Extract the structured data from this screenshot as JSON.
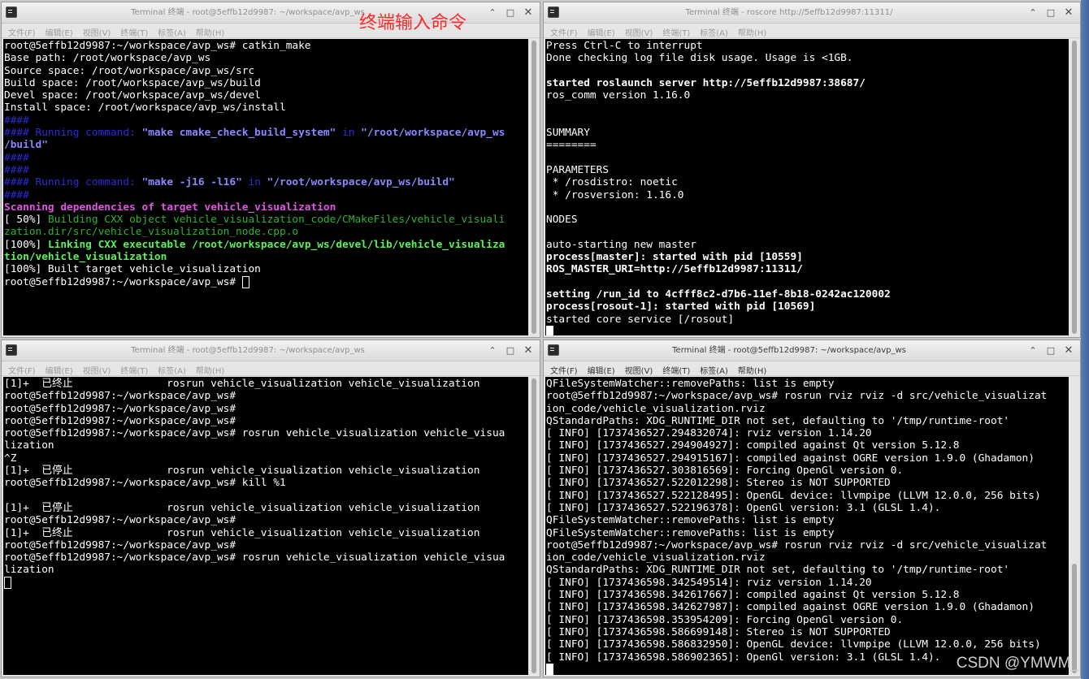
{
  "annotation": "终端输入命令",
  "watermark": "CSDN @YMWM_",
  "colors": {
    "terminal_bg": "#000000",
    "text": "#ffffff",
    "blue": "#2b2bd8",
    "light_blue": "#8888ff",
    "magenta": "#e055e0",
    "green": "#2fb22f",
    "light_green": "#5af25a",
    "annotation_red": "#ff2a2a"
  },
  "menu": [
    "文件(F)",
    "编辑(E)",
    "视图(V)",
    "终端(T)",
    "标签(A)",
    "帮助(H)"
  ],
  "controls": {
    "minimize": "⌃",
    "maximize": "□",
    "close": "✕"
  },
  "windows": [
    {
      "title": "Terminal 终端 - root@5effb12d9987: ~/workspace/avp_ws",
      "lines": [
        {
          "t": "root@5effb12d9987:~/workspace/avp_ws# catkin_make"
        },
        {
          "t": "Base path: /root/workspace/avp_ws"
        },
        {
          "t": "Source space: /root/workspace/avp_ws/src"
        },
        {
          "t": "Build space: /root/workspace/avp_ws/build"
        },
        {
          "t": "Devel space: /root/workspace/avp_ws/devel"
        },
        {
          "t": "Install space: /root/workspace/avp_ws/install"
        },
        {
          "t": "####",
          "c": "blue"
        },
        {
          "segs": [
            {
              "t": "#### Running command: ",
              "c": "blue"
            },
            {
              "t": "\"make cmake_check_build_system\"",
              "c": "lblue"
            },
            {
              "t": " in ",
              "c": "blue"
            },
            {
              "t": "\"/root/workspace/avp_ws",
              "c": "lblue"
            }
          ]
        },
        {
          "t": "/build\"",
          "c": "lblue"
        },
        {
          "t": "####",
          "c": "blue"
        },
        {
          "t": "####",
          "c": "blue"
        },
        {
          "segs": [
            {
              "t": "#### Running command: ",
              "c": "blue"
            },
            {
              "t": "\"make -j16 -l16\"",
              "c": "lblue"
            },
            {
              "t": " in ",
              "c": "blue"
            },
            {
              "t": "\"/root/workspace/avp_ws/build\"",
              "c": "lblue"
            }
          ]
        },
        {
          "t": "####",
          "c": "blue"
        },
        {
          "t": "Scanning dependencies of target vehicle_visualization",
          "c": "mag"
        },
        {
          "segs": [
            {
              "t": "[ 50%] "
            },
            {
              "t": "Building CXX object vehicle_visualization_code/CMakeFiles/vehicle_visuali",
              "c": "grn"
            }
          ]
        },
        {
          "t": "zation.dir/src/vehicle_visualization_node.cpp.o",
          "c": "grn"
        },
        {
          "segs": [
            {
              "t": "[100%] "
            },
            {
              "t": "Linking CXX executable /root/workspace/avp_ws/devel/lib/vehicle_visualiza",
              "c": "lgrn"
            }
          ]
        },
        {
          "t": "tion/vehicle_visualization",
          "c": "lgrn"
        },
        {
          "t": "[100%] Built target vehicle_visualization"
        },
        {
          "t": "root@5effb12d9987:~/workspace/avp_ws# ",
          "cursor": "hollow"
        }
      ]
    },
    {
      "title": "Terminal 终端 - roscore http://5effb12d9987:11311/",
      "lines": [
        {
          "t": "Press Ctrl-C to interrupt"
        },
        {
          "t": "Done checking log file disk usage. Usage is <1GB."
        },
        {
          "t": ""
        },
        {
          "t": "started roslaunch server http://5effb12d9987:38687/",
          "c": "b"
        },
        {
          "t": "ros_comm version 1.16.0"
        },
        {
          "t": ""
        },
        {
          "t": ""
        },
        {
          "t": "SUMMARY"
        },
        {
          "t": "========"
        },
        {
          "t": ""
        },
        {
          "t": "PARAMETERS"
        },
        {
          "t": " * /rosdistro: noetic"
        },
        {
          "t": " * /rosversion: 1.16.0"
        },
        {
          "t": ""
        },
        {
          "t": "NODES"
        },
        {
          "t": ""
        },
        {
          "t": "auto-starting new master"
        },
        {
          "t": "process[master]: started with pid [10559]",
          "c": "b"
        },
        {
          "t": "ROS_MASTER_URI=http://5effb12d9987:11311/",
          "c": "b"
        },
        {
          "t": ""
        },
        {
          "t": "setting /run_id to 4cfff8c2-d7b6-11ef-8b18-0242ac120002",
          "c": "b"
        },
        {
          "t": "process[rosout-1]: started with pid [10569]",
          "c": "b"
        },
        {
          "t": "started core service [/rosout]"
        },
        {
          "t": "",
          "cursor": "solid"
        }
      ]
    },
    {
      "title": "Terminal 终端 - root@5effb12d9987: ~/workspace/avp_ws",
      "lines": [
        {
          "t": "[1]+  已终止               rosrun vehicle_visualization vehicle_visualization"
        },
        {
          "t": "root@5effb12d9987:~/workspace/avp_ws#"
        },
        {
          "t": "root@5effb12d9987:~/workspace/avp_ws#"
        },
        {
          "t": "root@5effb12d9987:~/workspace/avp_ws#"
        },
        {
          "t": "root@5effb12d9987:~/workspace/avp_ws# rosrun vehicle_visualization vehicle_visua"
        },
        {
          "t": "lization"
        },
        {
          "t": "^Z"
        },
        {
          "t": "[1]+  已停止               rosrun vehicle_visualization vehicle_visualization"
        },
        {
          "t": "root@5effb12d9987:~/workspace/avp_ws# kill %1"
        },
        {
          "t": ""
        },
        {
          "t": "[1]+  已停止               rosrun vehicle_visualization vehicle_visualization"
        },
        {
          "t": "root@5effb12d9987:~/workspace/avp_ws#"
        },
        {
          "t": "[1]+  已终止               rosrun vehicle_visualization vehicle_visualization"
        },
        {
          "t": "root@5effb12d9987:~/workspace/avp_ws#"
        },
        {
          "t": "root@5effb12d9987:~/workspace/avp_ws# rosrun vehicle_visualization vehicle_visua"
        },
        {
          "t": "lization"
        },
        {
          "t": "",
          "cursor": "hollow"
        }
      ]
    },
    {
      "title": "Terminal 终端 - root@5effb12d9987: ~/workspace/avp_ws",
      "lines": [
        {
          "t": "QFileSystemWatcher::removePaths: list is empty"
        },
        {
          "t": "root@5effb12d9987:~/workspace/avp_ws# rosrun rviz rviz -d src/vehicle_visualizat"
        },
        {
          "t": "ion_code/vehicle_visualization.rviz"
        },
        {
          "t": "QStandardPaths: XDG_RUNTIME_DIR not set, defaulting to '/tmp/runtime-root'"
        },
        {
          "t": "[ INFO] [1737436527.294832074]: rviz version 1.14.20"
        },
        {
          "t": "[ INFO] [1737436527.294904927]: compiled against Qt version 5.12.8"
        },
        {
          "t": "[ INFO] [1737436527.294915167]: compiled against OGRE version 1.9.0 (Ghadamon)"
        },
        {
          "t": "[ INFO] [1737436527.303816569]: Forcing OpenGl version 0."
        },
        {
          "t": "[ INFO] [1737436527.522012298]: Stereo is NOT SUPPORTED"
        },
        {
          "t": "[ INFO] [1737436527.522128495]: OpenGL device: llvmpipe (LLVM 12.0.0, 256 bits)"
        },
        {
          "t": "[ INFO] [1737436527.522196378]: OpenGl version: 3.1 (GLSL 1.4)."
        },
        {
          "t": "QFileSystemWatcher::removePaths: list is empty"
        },
        {
          "t": "QFileSystemWatcher::removePaths: list is empty"
        },
        {
          "t": "root@5effb12d9987:~/workspace/avp_ws# rosrun rviz rviz -d src/vehicle_visualizat"
        },
        {
          "t": "ion_code/vehicle_visualization.rviz"
        },
        {
          "t": "QStandardPaths: XDG_RUNTIME_DIR not set, defaulting to '/tmp/runtime-root'"
        },
        {
          "t": "[ INFO] [1737436598.342549514]: rviz version 1.14.20"
        },
        {
          "t": "[ INFO] [1737436598.342617667]: compiled against Qt version 5.12.8"
        },
        {
          "t": "[ INFO] [1737436598.342627987]: compiled against OGRE version 1.9.0 (Ghadamon)"
        },
        {
          "t": "[ INFO] [1737436598.353954209]: Forcing OpenGl version 0."
        },
        {
          "t": "[ INFO] [1737436598.586699148]: Stereo is NOT SUPPORTED"
        },
        {
          "t": "[ INFO] [1737436598.586832950]: OpenGL device: llvmpipe (LLVM 12.0.0, 256 bits)"
        },
        {
          "t": "[ INFO] [1737436598.586902365]: OpenGl version: 3.1 (GLSL 1.4)."
        },
        {
          "t": "",
          "cursor": "solid"
        }
      ]
    }
  ]
}
